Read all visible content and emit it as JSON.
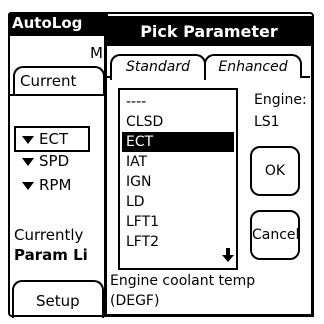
{
  "background_app": {
    "title": "AutoLog",
    "header_fragment": "M",
    "tab_current": "Current",
    "params": [
      "ECT",
      "SPD",
      "RPM"
    ],
    "currently_label": "Currently",
    "param_list_label": "Param Li",
    "setup_tab": "Setup"
  },
  "dialog": {
    "title": "Pick Parameter",
    "tabs": [
      {
        "label": "Standard",
        "selected": true
      },
      {
        "label": "Enhanced",
        "selected": false
      }
    ],
    "list": {
      "items": [
        "----",
        "CLSD",
        "ECT",
        "IAT",
        "IGN",
        "LD",
        "LFT1",
        "LFT2"
      ],
      "selected": "ECT"
    },
    "engine_label": "Engine:",
    "engine_value": "LS1",
    "ok_label": "OK",
    "cancel_label": "Cancel",
    "description_line1": "Engine coolant temp",
    "description_line2": "(DEGF)"
  }
}
